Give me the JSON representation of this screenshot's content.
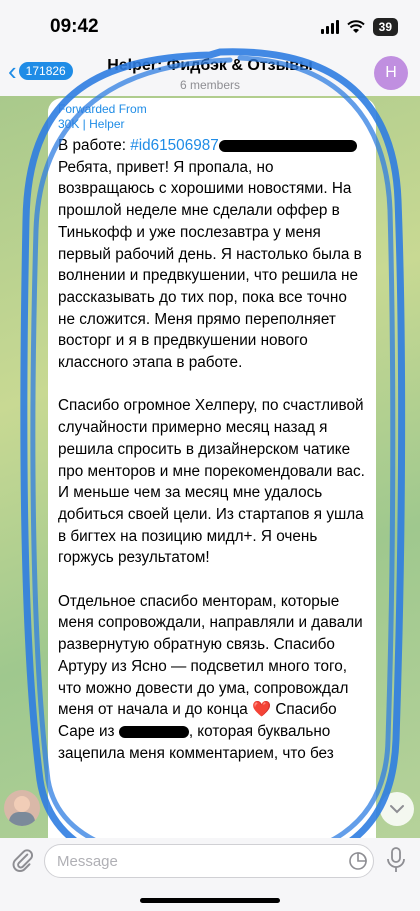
{
  "status_bar": {
    "time": "09:42",
    "battery": "39"
  },
  "header": {
    "back_count": "171826",
    "title": "Helper: Фидбэк & Отзывы",
    "subtitle": "6 members",
    "avatar_letter": "H"
  },
  "message": {
    "forwarded_label": "Forwarded From",
    "forwarded_source": "30K | Helper",
    "line1_prefix": "В работе: ",
    "hashtag": "#id61506987",
    "p1": "Ребята, привет! Я пропала, но возвращаюсь с хорошими новостями. На прошлой неделе мне сделали оффер в Тинькофф и уже послезавтра у меня первый рабочий день. Я настолько была в волнении и предвкушении, что решила не рассказывать до тих пор, пока все точно не сложится. Меня прямо переполняет восторг и я в предвкушении нового классного этапа в работе.",
    "p2": "Спасибо огромное Хелперу, по счастливой случайности примерно месяц назад я решила спросить в дизайнерском чатике про менторов и мне порекомендовали вас. И меньше чем за месяц мне удалось добиться своей цели. Из стартапов я ушла в бигтех на позицию мидл+. Я очень горжусь результатом!",
    "p3_a": "Отдельное спасибо менторам, которые меня сопровождали, направляли и давали развернутую обратную связь. Спасибо Артуру из Ясно — подсветил много того, что можно довести до ума, сопровождал меня от начала и до конца ",
    "heart": "❤️",
    "p3_b": " Спасибо Саре из ",
    "p3_c": ", которая буквально зацепила меня комментарием, что без"
  },
  "input": {
    "placeholder": "Message"
  },
  "icons": {
    "attach": "paperclip-icon",
    "sticker": "sticker-icon",
    "mic": "microphone-icon",
    "scroll": "chevron-down-icon",
    "back": "chevron-left-icon"
  },
  "colors": {
    "accent": "#1f8ce6",
    "marker": "#2f7de1",
    "avatar": "#c08fe0"
  }
}
